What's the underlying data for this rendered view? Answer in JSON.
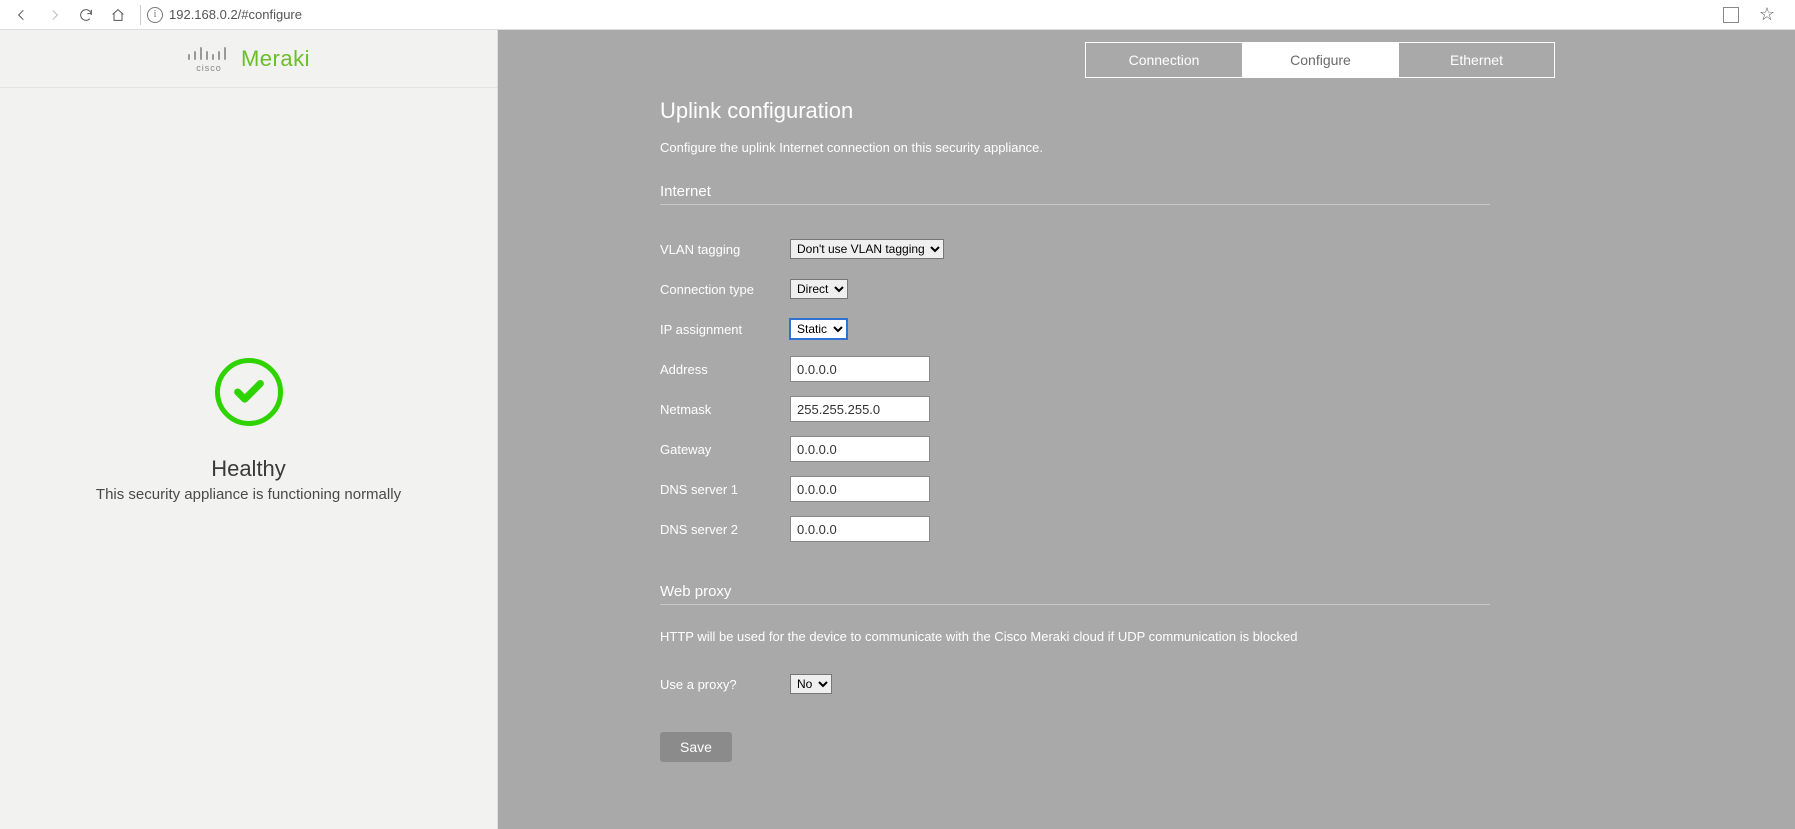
{
  "browser": {
    "url": "192.168.0.2/#configure"
  },
  "logo": {
    "cisco": "cisco",
    "meraki": "Meraki"
  },
  "status": {
    "title": "Healthy",
    "subtitle": "This security appliance is functioning normally"
  },
  "tabs": {
    "connection": "Connection",
    "configure": "Configure",
    "ethernet": "Ethernet"
  },
  "page": {
    "title": "Uplink configuration",
    "description": "Configure the uplink Internet connection on this security appliance."
  },
  "internet": {
    "heading": "Internet",
    "vlan_label": "VLAN tagging",
    "vlan_value": "Don't use VLAN tagging",
    "conn_label": "Connection type",
    "conn_value": "Direct",
    "ipassign_label": "IP assignment",
    "ipassign_value": "Static",
    "address_label": "Address",
    "address_value": "0.0.0.0",
    "netmask_label": "Netmask",
    "netmask_value": "255.255.255.0",
    "gateway_label": "Gateway",
    "gateway_value": "0.0.0.0",
    "dns1_label": "DNS server 1",
    "dns1_value": "0.0.0.0",
    "dns2_label": "DNS server 2",
    "dns2_value": "0.0.0.0"
  },
  "proxy": {
    "heading": "Web proxy",
    "description": "HTTP will be used for the device to communicate with the Cisco Meraki cloud if UDP communication is blocked",
    "use_label": "Use a proxy?",
    "use_value": "No"
  },
  "actions": {
    "save": "Save"
  }
}
